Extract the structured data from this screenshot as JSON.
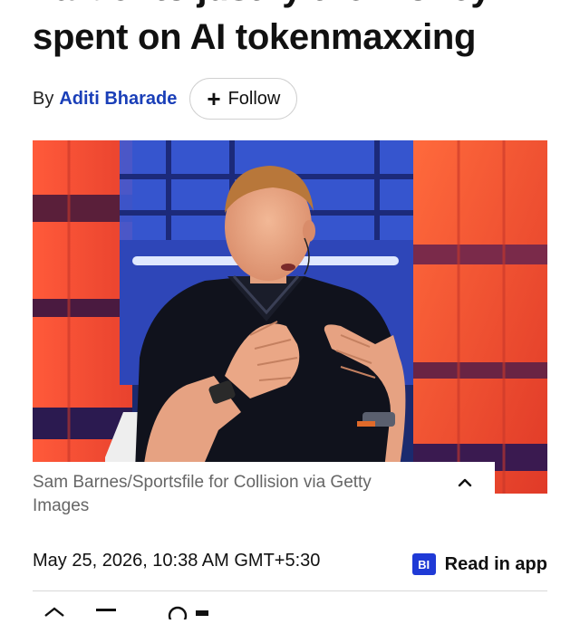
{
  "article": {
    "headline_line1": "harder to justify the money",
    "headline_line2": "spent on AI tokenmaxxing",
    "byline_prefix": "By",
    "author": "Aditi Bharade",
    "follow_label": "Follow",
    "image_caption": "Sam Barnes/Sportsfile for Collision via Getty Images",
    "dateline": "May 25, 2026, 10:38 AM GMT+5:30",
    "read_in_app_label": "Read in app",
    "app_badge": "BI"
  },
  "icons": {
    "follow": "plus-icon",
    "caption_toggle": "chevron-up-icon",
    "app": "business-insider-badge-icon"
  },
  "colors": {
    "author_link": "#1a3fb8",
    "badge_bg": "#1f3ad6",
    "caption_text": "#666666"
  }
}
